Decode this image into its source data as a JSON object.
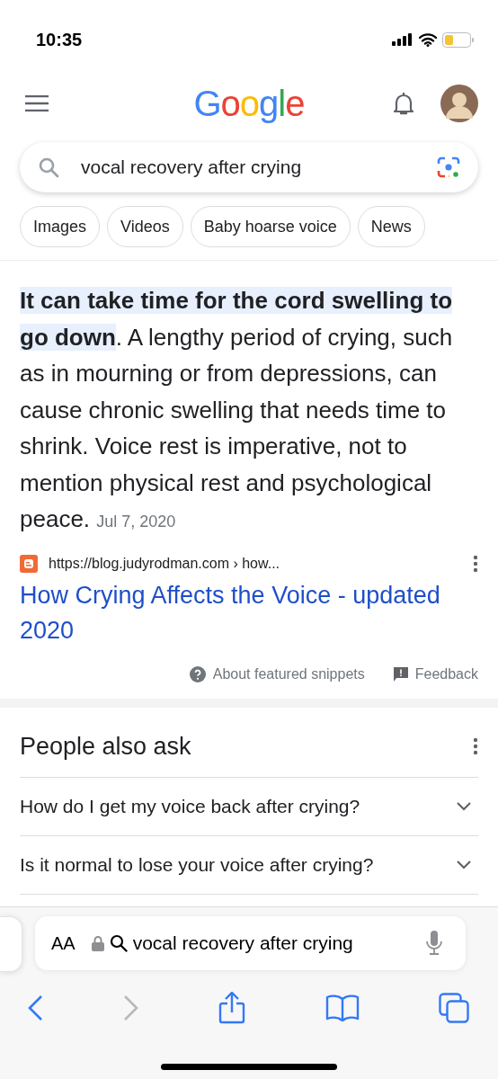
{
  "status_bar": {
    "time": "10:35"
  },
  "header": {
    "logo": "Google"
  },
  "search": {
    "value": "vocal recovery after crying"
  },
  "chips": [
    {
      "label": "Images"
    },
    {
      "label": "Videos"
    },
    {
      "label": "Baby hoarse voice"
    },
    {
      "label": "News"
    }
  ],
  "snippet": {
    "highlight": "It can take time for the cord swelling to go down",
    "text": ". A lengthy period of crying, such as in mourning or from depressions, can cause chronic swelling that needs time to shrink. Voice rest is imperative, not to mention physical rest and psychological peace.",
    "date": "Jul 7, 2020"
  },
  "source": {
    "url": "https://blog.judyrodman.com › how...",
    "title": "How Crying Affects the Voice - updated 2020"
  },
  "snippet_footer": {
    "about": "About featured snippets",
    "feedback": "Feedback"
  },
  "people_also_ask": {
    "title": "People also ask",
    "questions": [
      {
        "text": "How do I get my voice back after crying?",
        "expanded": false
      },
      {
        "text": "Is it normal to lose your voice after crying?",
        "expanded": false
      }
    ]
  },
  "address_bar": {
    "text_size": "AA",
    "value": "vocal recovery after crying"
  }
}
